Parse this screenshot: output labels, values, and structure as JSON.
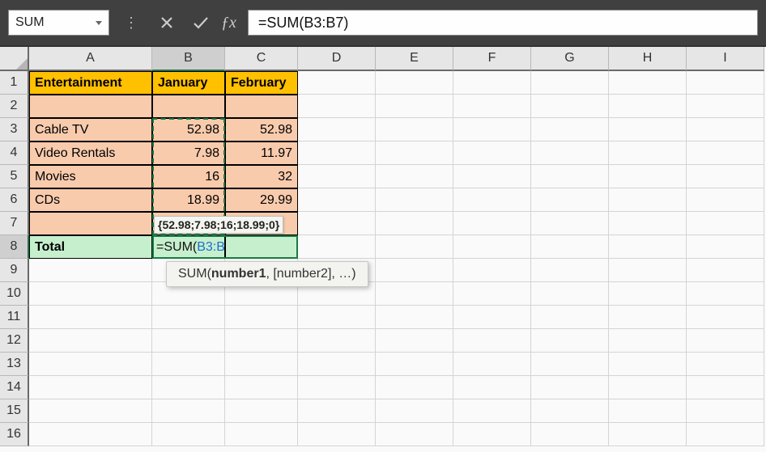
{
  "name_box": "SUM",
  "formula_bar": "=SUM(B3:B7)",
  "columns": [
    "A",
    "B",
    "C",
    "D",
    "E",
    "F",
    "G",
    "H",
    "I"
  ],
  "rows": [
    "1",
    "2",
    "3",
    "4",
    "5",
    "6",
    "7",
    "8",
    "9",
    "10",
    "11",
    "12",
    "13",
    "14",
    "15",
    "16"
  ],
  "sheet": {
    "headers": {
      "A1": "Entertainment",
      "B1": "January",
      "C1": "February"
    },
    "data": [
      {
        "label": "Cable TV",
        "jan": "52.98",
        "feb": "52.98"
      },
      {
        "label": "Video Rentals",
        "jan": "7.98",
        "feb": "11.97"
      },
      {
        "label": "Movies",
        "jan": "16",
        "feb": "32"
      },
      {
        "label": "CDs",
        "jan": "18.99",
        "feb": "29.99"
      }
    ],
    "total_label": "Total",
    "editing_formula_prefix": "=SUM(",
    "editing_formula_ref": "B3:B7",
    "editing_formula_suffix": ")"
  },
  "array_tooltip": "{52.98;7.98;16;18.99;0}",
  "fn_tooltip": {
    "name": "SUM",
    "arg_bold": "number1",
    "rest": ", [number2], …)"
  },
  "chart_data": {
    "type": "table",
    "title": "Entertainment",
    "columns": [
      "January",
      "February"
    ],
    "rows": [
      "Cable TV",
      "Video Rentals",
      "Movies",
      "CDs"
    ],
    "values": [
      [
        52.98,
        52.98
      ],
      [
        7.98,
        11.97
      ],
      [
        16,
        32
      ],
      [
        18.99,
        29.99
      ]
    ]
  }
}
